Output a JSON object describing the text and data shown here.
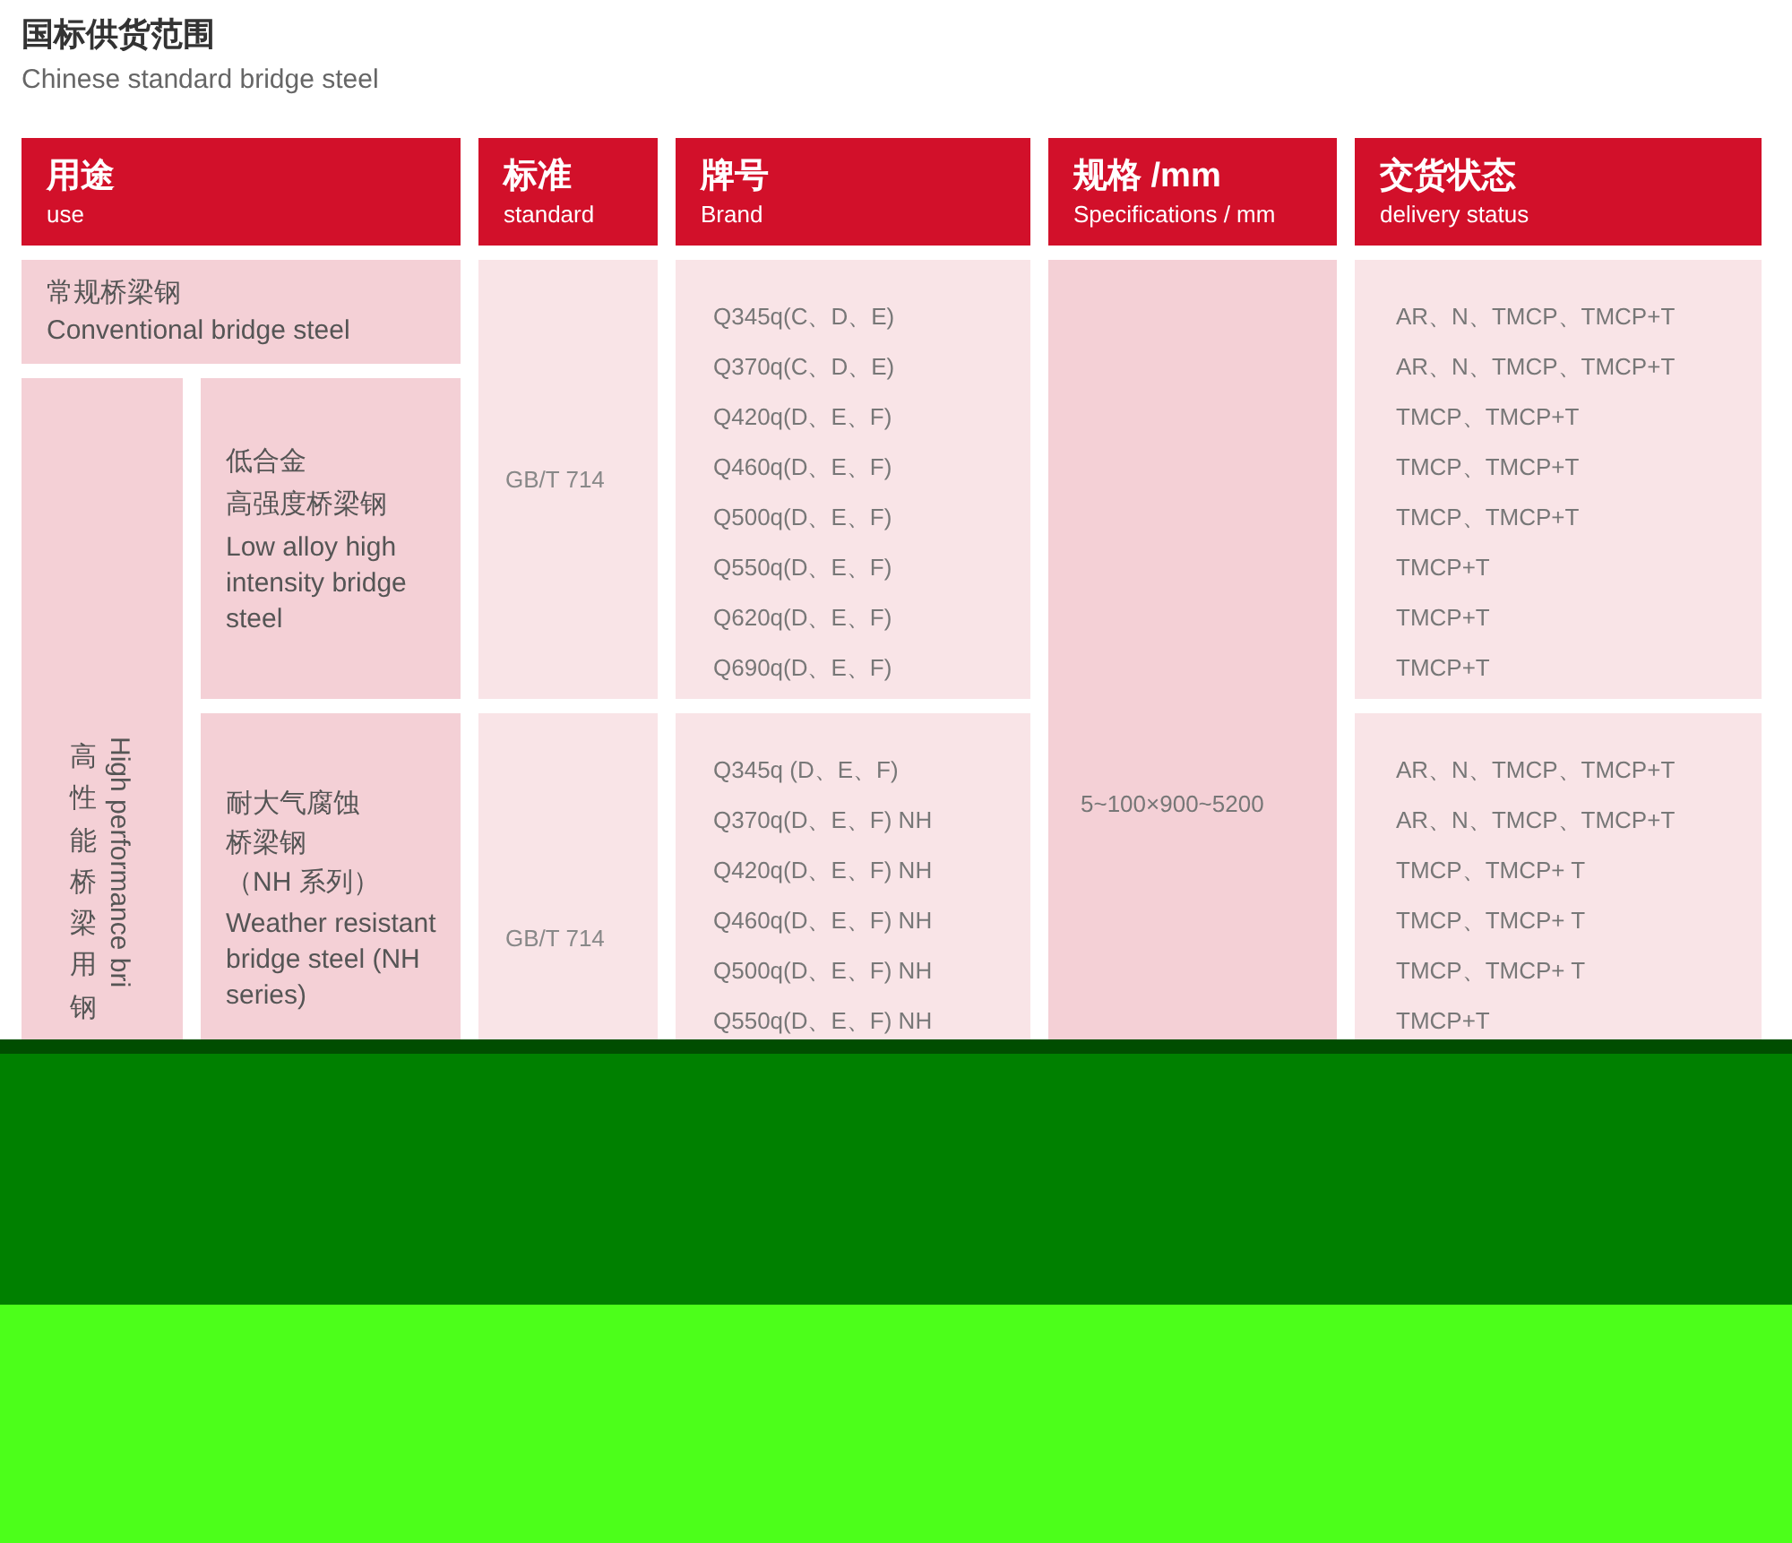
{
  "title": "国标供货范围",
  "subtitle": "Chinese standard bridge steel",
  "columns": [
    {
      "zh": "用途",
      "en": "use"
    },
    {
      "zh": "标准",
      "en": "standard"
    },
    {
      "zh": "牌号",
      "en": "Brand"
    },
    {
      "zh": "规格 /mm",
      "en": "Specifications / mm"
    },
    {
      "zh": "交货状态",
      "en": "delivery status"
    }
  ],
  "conventional": {
    "zh": "常规桥梁钢",
    "en": "Conventional bridge steel"
  },
  "high_performance": {
    "zh": "高性能桥梁用钢",
    "en": "High performance bri"
  },
  "specification": "5~100×900~5200",
  "groups": [
    {
      "zh_lines": [
        "低合金",
        "高强度桥梁钢"
      ],
      "en": "Low alloy high intensity bridge steel",
      "standard": "GB/T 714",
      "brands": [
        "Q345q(C、D、E)",
        "Q370q(C、D、E)",
        "Q420q(D、E、F)",
        "Q460q(D、E、F)",
        "Q500q(D、E、F)",
        "Q550q(D、E、F)",
        "Q620q(D、E、F)",
        "Q690q(D、E、F)"
      ],
      "delivery": [
        "AR、N、TMCP、TMCP+T",
        "AR、N、TMCP、TMCP+T",
        "TMCP、TMCP+T",
        "TMCP、TMCP+T",
        "TMCP、TMCP+T",
        "TMCP+T",
        "TMCP+T",
        "TMCP+T"
      ]
    },
    {
      "zh_lines": [
        "耐大气腐蚀",
        "桥梁钢",
        "（NH 系列）"
      ],
      "en": "Weather resistant bridge steel (NH series)",
      "standard": "GB/T 714",
      "brands": [
        "Q345q (D、E、F)",
        "Q370q(D、E、F) NH",
        "Q420q(D、E、F) NH",
        "Q460q(D、E、F) NH",
        "Q500q(D、E、F) NH",
        "Q550q(D、E、F) NH"
      ],
      "delivery": [
        "AR、N、TMCP、TMCP+T",
        "AR、N、TMCP、TMCP+T",
        "TMCP、TMCP+ T",
        "TMCP、TMCP+ T",
        "TMCP、TMCP+ T",
        "TMCP+T"
      ]
    }
  ]
}
